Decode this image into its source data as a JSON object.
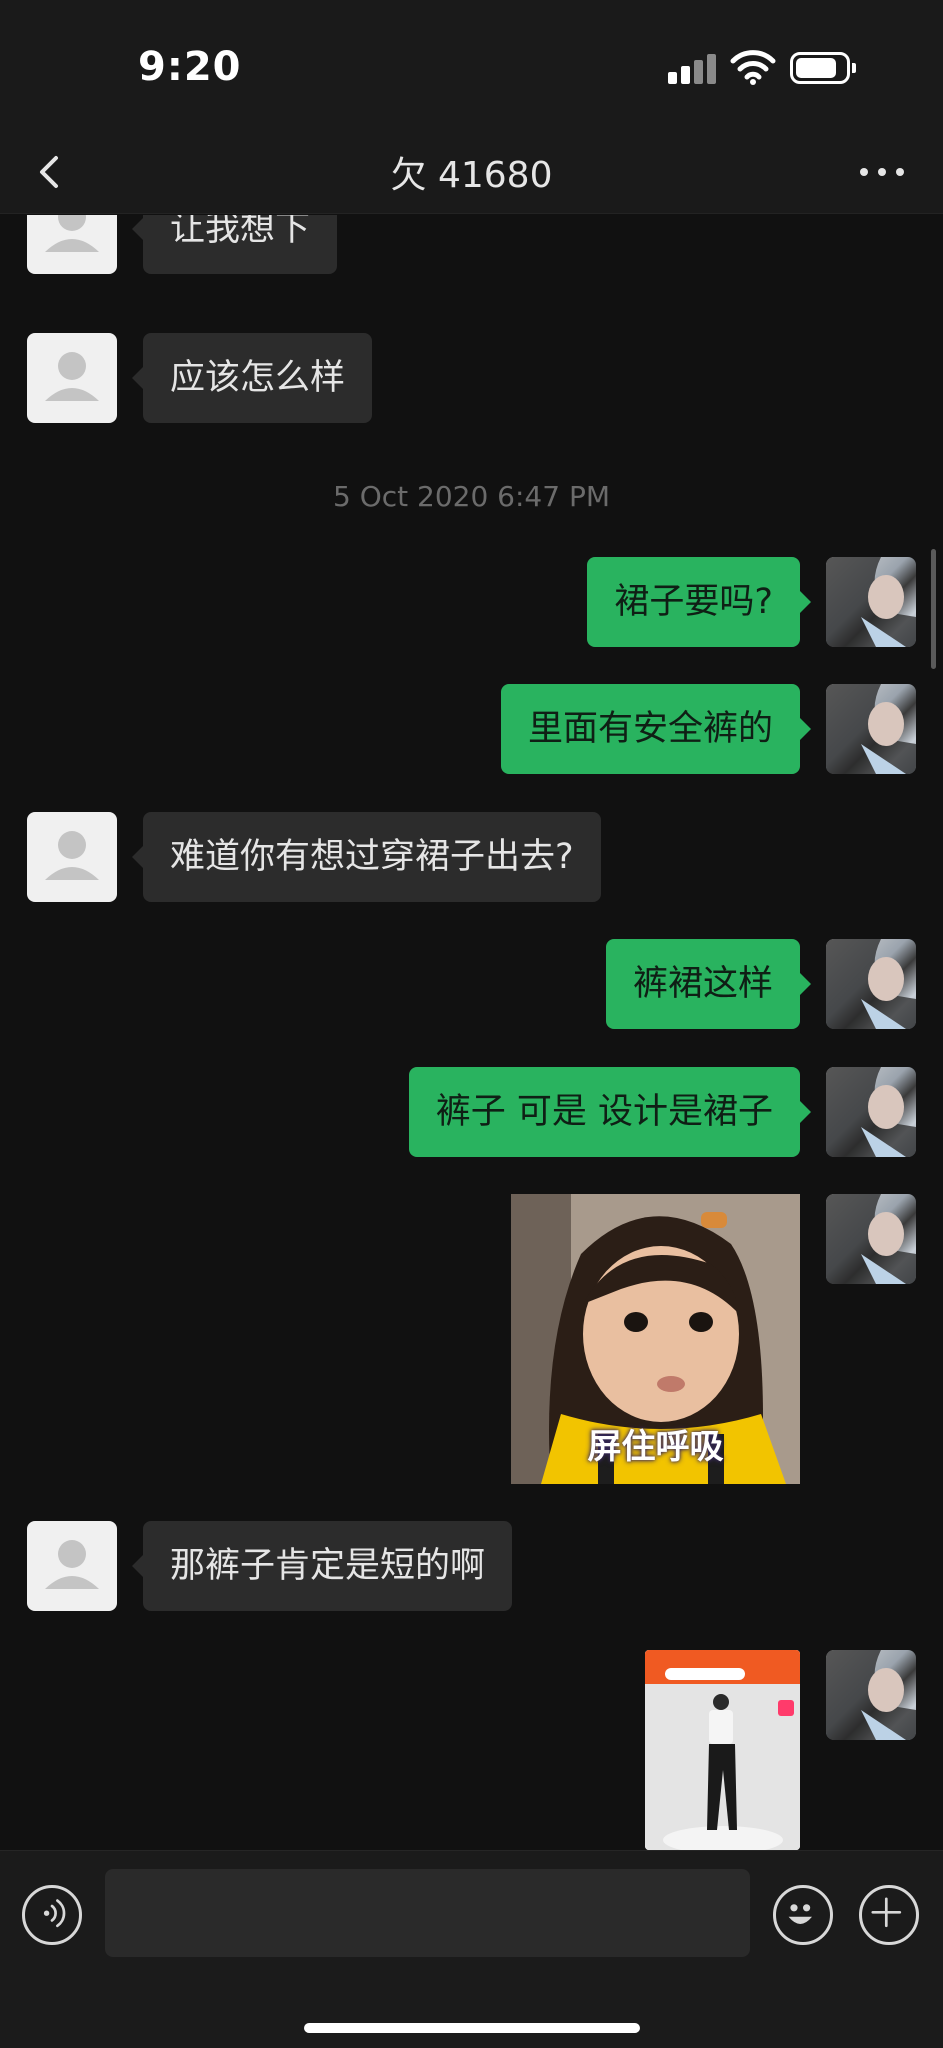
{
  "status_bar": {
    "time": "9:20"
  },
  "nav": {
    "title": "欠 41680"
  },
  "messages": [
    {
      "side": "in",
      "type": "text",
      "text": "让我想下"
    },
    {
      "side": "in",
      "type": "text",
      "text": "应该怎么样"
    },
    {
      "type": "timestamp",
      "text": "5 Oct 2020 6:47 PM"
    },
    {
      "side": "out",
      "type": "text",
      "text": "裙子要吗?"
    },
    {
      "side": "out",
      "type": "text",
      "text": "里面有安全裤的"
    },
    {
      "side": "in",
      "type": "text",
      "text": "难道你有想过穿裙子出去?"
    },
    {
      "side": "out",
      "type": "text",
      "text": "裤裙这样"
    },
    {
      "side": "out",
      "type": "text",
      "text": "裤子 可是 设计是裙子"
    },
    {
      "side": "out",
      "type": "sticker",
      "caption": "屏住呼吸"
    },
    {
      "side": "in",
      "type": "text",
      "text": "那裤子肯定是短的啊"
    },
    {
      "side": "out",
      "type": "image",
      "description": "product screenshot"
    }
  ],
  "input": {
    "placeholder": ""
  },
  "colors": {
    "background": "#111111",
    "bubble_in": "#2c2c2c",
    "bubble_out": "#29b35f",
    "timestamp": "#6b6b6b"
  },
  "icons": [
    "back-icon",
    "more-icon",
    "signal-icon",
    "wifi-icon",
    "battery-icon",
    "voice-icon",
    "emoji-icon",
    "plus-icon"
  ]
}
